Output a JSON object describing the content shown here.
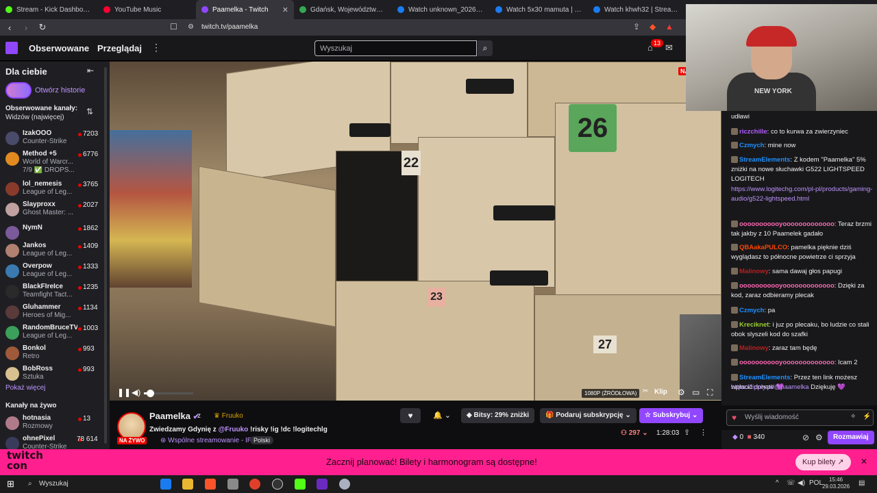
{
  "browser": {
    "tabs": [
      {
        "title": "Stream - Kick Dashboard",
        "color": "#53fc18"
      },
      {
        "title": "YouTube Music",
        "color": "#ff0033"
      },
      {
        "title": "Paamelka - Twitch",
        "color": "#9146ff",
        "active": true
      },
      {
        "title": "Gdańsk, Województwo pomor...",
        "color": "#34a853"
      },
      {
        "title": "Watch unknown_2026.01.18-1...",
        "color": "#1a7cf0"
      },
      {
        "title": "Watch 5x30 mamuta | Streama...",
        "color": "#1a7cf0"
      },
      {
        "title": "Watch khwh32 | Streamable",
        "color": "#1a7cf0"
      }
    ],
    "url": "twitch.tv/paamelka"
  },
  "nav": {
    "followed": "Obserwowane",
    "browse": "Przeglądaj",
    "search_placeholder": "Wyszukaj",
    "notifications": "13"
  },
  "sidebar": {
    "title": "Dla ciebie",
    "stories": "Otwórz historie",
    "followed_title": "Obserwowane kanały:",
    "followed_sort": "Widzów (najwięcej)",
    "channels": [
      {
        "name": "IzakOOO",
        "game": "Counter-Strike",
        "viewers": "7203",
        "color": "#4a4a6a"
      },
      {
        "name": "Method +5",
        "game": "World of Warcr...",
        "sub2": "7/9 ✅ DROPS...",
        "viewers": "6776",
        "color": "#e08a20"
      },
      {
        "name": "lol_nemesis",
        "game": "League of Leg...",
        "viewers": "3765",
        "color": "#8a3a2a"
      },
      {
        "name": "Slayproxx",
        "game": "Ghost Master: ...",
        "viewers": "2027",
        "color": "#c0a0a0"
      },
      {
        "name": "NymN",
        "game": "",
        "viewers": "1862",
        "color": "#7a5a9a"
      },
      {
        "name": "Jankos",
        "game": "League of Leg...",
        "viewers": "1409",
        "color": "#b08070"
      },
      {
        "name": "Overpow",
        "game": "League of Leg...",
        "viewers": "1333",
        "color": "#3a7ab0"
      },
      {
        "name": "BlackFIreIce",
        "game": "Teamfight Tact...",
        "viewers": "1235",
        "color": "#2a2a2a"
      },
      {
        "name": "Gluhammer",
        "game": "Heroes of Mig...",
        "viewers": "1134",
        "color": "#5a3a3a"
      },
      {
        "name": "RandomBruceTV",
        "game": "League of Leg...",
        "viewers": "1003",
        "color": "#3aa05a"
      },
      {
        "name": "Bonkol",
        "game": "Retro",
        "viewers": "993",
        "color": "#a05a3a"
      },
      {
        "name": "BobRoss",
        "game": "Sztuka",
        "viewers": "993",
        "color": "#d8c090"
      }
    ],
    "show_more": "Pokaż więcej",
    "live_title": "Kanały na żywo",
    "live_channels": [
      {
        "name": "hotnasia",
        "game": "Rozmowy",
        "viewers": "13",
        "color": "#b07a8a"
      },
      {
        "name": "ohnePixel",
        "game": "Counter-Strike",
        "viewers": "78 614",
        "color": "#3a3a5a"
      }
    ]
  },
  "player": {
    "quality": "1080P (ŹRÓDŁOWA)",
    "clip": "Klip",
    "live_corner": "NA",
    "volume": 0.12,
    "locker_numbers": [
      "26",
      "22",
      "23",
      "27"
    ]
  },
  "stream": {
    "streamer": "Paamelka",
    "with": "z",
    "partner": "Fruuko",
    "title_pre": "Zwiedzamy Gdynię z ",
    "title_mention": "@Fruuko",
    "title_post": " !risky !ig !dc !logitechlg",
    "live": "NA ŻYWO",
    "collab": "Wspólne streamowanie - IRL",
    "language": "Polski",
    "bits": "Bitsy: 29% zniżki",
    "gift": "Podaruj subskrypcję",
    "subscribe": "Subskrybuj",
    "viewers": "297",
    "uptime": "1:28:03"
  },
  "chat": {
    "messages": [
      {
        "user": "",
        "text": "udławi",
        "ucolor": "#efeff1"
      },
      {
        "user": "riczchille",
        "text": ": co to kurwa za zwierzyniec",
        "ucolor": "#b05cff"
      },
      {
        "user": "Czmych",
        "text": ": mine now",
        "ucolor": "#1e90ff"
      },
      {
        "user": "StreamElements",
        "text": ": Z kodem \"Paamelka\" 5% zniżki na nowe słuchawki G522 LIGHTSPEED LOGITECH",
        "ucolor": "#1e90ff"
      },
      {
        "user": "",
        "text": "https://www.logitechg.com/pl-pl/products/gaming-audio/g522-lightspeed.html",
        "ucolor": "#bf94ff"
      },
      {
        "user": "ooooooooooyooooooooooooo",
        "text": ": Teraz brzmi tak jakby z 10 Paamelek gadało",
        "ucolor": "#ff69b4"
      },
      {
        "user": "QBAakaPULCO",
        "text": ": pamelka pięknie dziś wyglądasz to północne powietrze ci sprzyja",
        "ucolor": "#ff4500"
      },
      {
        "user": "Malinowy",
        "text": ": sama dawaj głos papugi",
        "ucolor": "#b22222"
      },
      {
        "user": "ooooooooooyooooooooooooo",
        "text": ": Dzięki za kod, zaraz odbieramy plecak",
        "ucolor": "#ff69b4"
      },
      {
        "user": "Czmych",
        "text": ": pa",
        "ucolor": "#1e90ff"
      },
      {
        "user": "Kreciknet",
        "text": ": i juz po plecaku, bo ludzie co stali obok slyszeli kod do szafki",
        "ucolor": "#9acd32"
      },
      {
        "user": "Malinowy",
        "text": ": zaraz tam będę",
        "ucolor": "#b22222"
      },
      {
        "user": "ooooooooooyooooooooooooo",
        "text": ": Icam 2",
        "ucolor": "#ff69b4"
      },
      {
        "user": "StreamElements",
        "text": ": Przez ten link możesz wpłacić donate 💜",
        "ucolor": "#1e90ff"
      },
      {
        "user": "",
        "text": "https://tipply.pl/@paamelka",
        "ucolor": "#bf94ff",
        "tail": " Dziękuję 💜"
      }
    ],
    "input_placeholder": "Wyślij wiadomość",
    "points_a": "0",
    "points_b": "340",
    "chat_button": "Rozmawiaj"
  },
  "banner": {
    "logo_line1": "twitch",
    "logo_line2": "con",
    "text": "Zacznij planować! Bilety i harmonogram są dostępne!",
    "button": "Kup bilety ↗"
  },
  "taskbar": {
    "search": "Wyszukaj",
    "lang": "POL",
    "time": "15:46",
    "date": "29.03.2026"
  }
}
